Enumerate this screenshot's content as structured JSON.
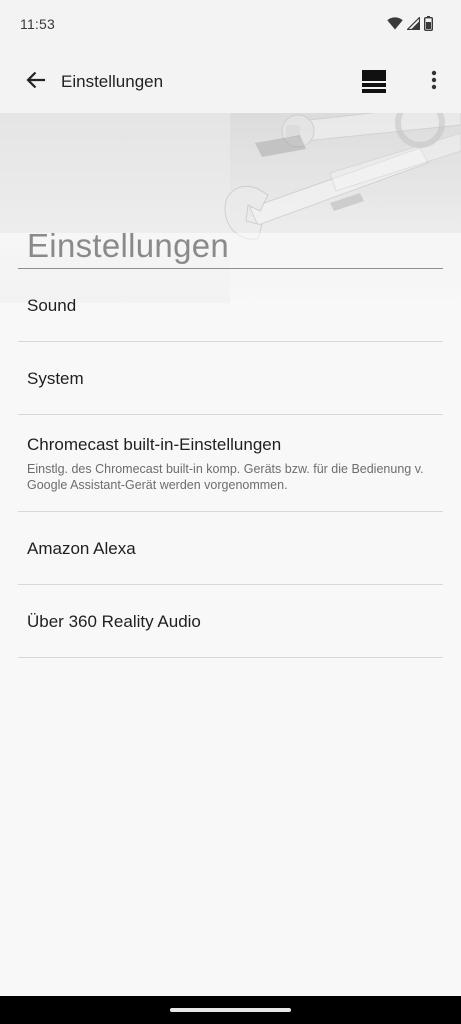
{
  "status_bar": {
    "time": "11:53",
    "icons": [
      "wifi-icon",
      "cellular-signal-icon",
      "battery-icon"
    ]
  },
  "app_bar": {
    "title": "Einstellungen",
    "back_icon": "arrow-left-icon",
    "view_icon": "list-view-icon",
    "menu_icon": "more-vertical-icon"
  },
  "header": {
    "section_title": "Einstellungen",
    "banner_image": "wrenches-illustration"
  },
  "settings": [
    {
      "title": "Sound"
    },
    {
      "title": "System"
    },
    {
      "title": "Chromecast built-in-Einstellungen",
      "description": "Einstlg. des Chromecast built-in komp. Geräts bzw. für die Bedienung v. Google Assistant-Gerät werden vorgenommen."
    },
    {
      "title": "Amazon Alexa"
    },
    {
      "title": "Über 360 Reality Audio"
    }
  ],
  "colors": {
    "background": "#f8f8f8",
    "section_title": "#8a8a8a",
    "divider": "#d8d8d8",
    "nav_bar": "#000000"
  }
}
